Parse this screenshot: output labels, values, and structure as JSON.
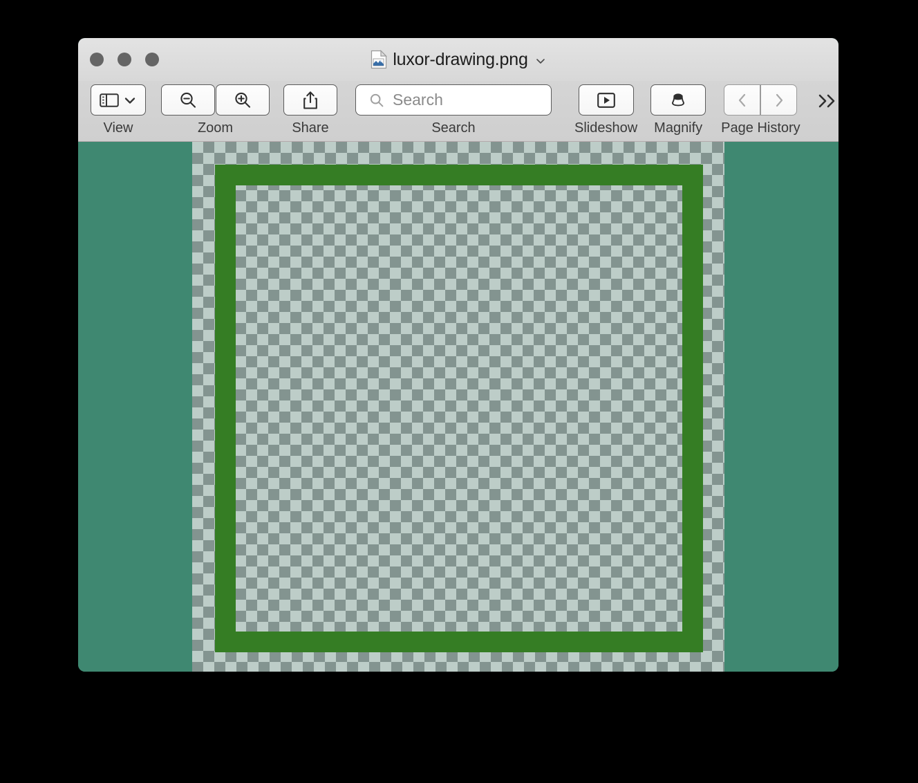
{
  "window": {
    "app": "Preview",
    "title": "luxor-drawing.png",
    "title_icon": "png-document-icon",
    "title_chevron_icon": "chevron-down-icon",
    "traffic_lights": [
      {
        "name": "close-button",
        "label": "Close"
      },
      {
        "name": "minimize-button",
        "label": "Minimize"
      },
      {
        "name": "zoom-button",
        "label": "Zoom"
      }
    ],
    "traffic_light_color": "#656565"
  },
  "toolbar": {
    "groups": [
      {
        "name": "view",
        "label": "View",
        "icon": "sidebar-panel-icon",
        "has_chevron": true
      },
      {
        "name": "zoom",
        "label": "Zoom",
        "icons": [
          "zoom-out-icon",
          "zoom-in-icon"
        ]
      },
      {
        "name": "share",
        "label": "Share",
        "icon": "share-icon"
      },
      {
        "name": "search",
        "label": "Search",
        "icon": "search-icon"
      },
      {
        "name": "slideshow",
        "label": "Slideshow",
        "icon": "play-icon"
      },
      {
        "name": "magnify",
        "label": "Magnify",
        "icon": "loupe-icon"
      },
      {
        "name": "page-history",
        "label": "Page History",
        "icons": [
          "chevron-left-icon",
          "chevron-right-icon"
        ]
      }
    ],
    "search": {
      "placeholder": "Search",
      "value": ""
    },
    "overflow_label": "»"
  },
  "canvas": {
    "background_color": "#3f8871",
    "checker_light": "#bdcdc8",
    "checker_dark": "#839490",
    "checker_size_px": 16,
    "artwork": {
      "name": "green-frame-rectangle",
      "stroke_color": "#357d24",
      "stroke_width_px": 30
    }
  }
}
